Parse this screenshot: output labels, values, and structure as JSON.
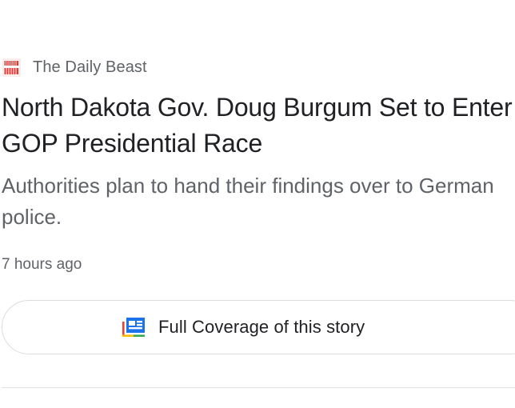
{
  "article": {
    "source": {
      "name": "The Daily Beast",
      "logo_icon": "daily-beast-logo",
      "logo_color": "#e53935"
    },
    "headline": "North Dakota Gov. Doug Burgum Set to Enter GOP Presidential Race",
    "snippet": "Authorities plan to hand their findings over to German police.",
    "timestamp": "7 hours ago"
  },
  "full_coverage": {
    "label": "Full Coverage of this story",
    "icon": "full-coverage-icon"
  },
  "colors": {
    "headline": "#202124",
    "secondary_text": "#5f6368",
    "border": "#dadce0",
    "icon_blue": "#1a73e8",
    "icon_red": "#ea4335",
    "icon_yellow": "#fbbc04",
    "icon_green": "#34a853"
  }
}
